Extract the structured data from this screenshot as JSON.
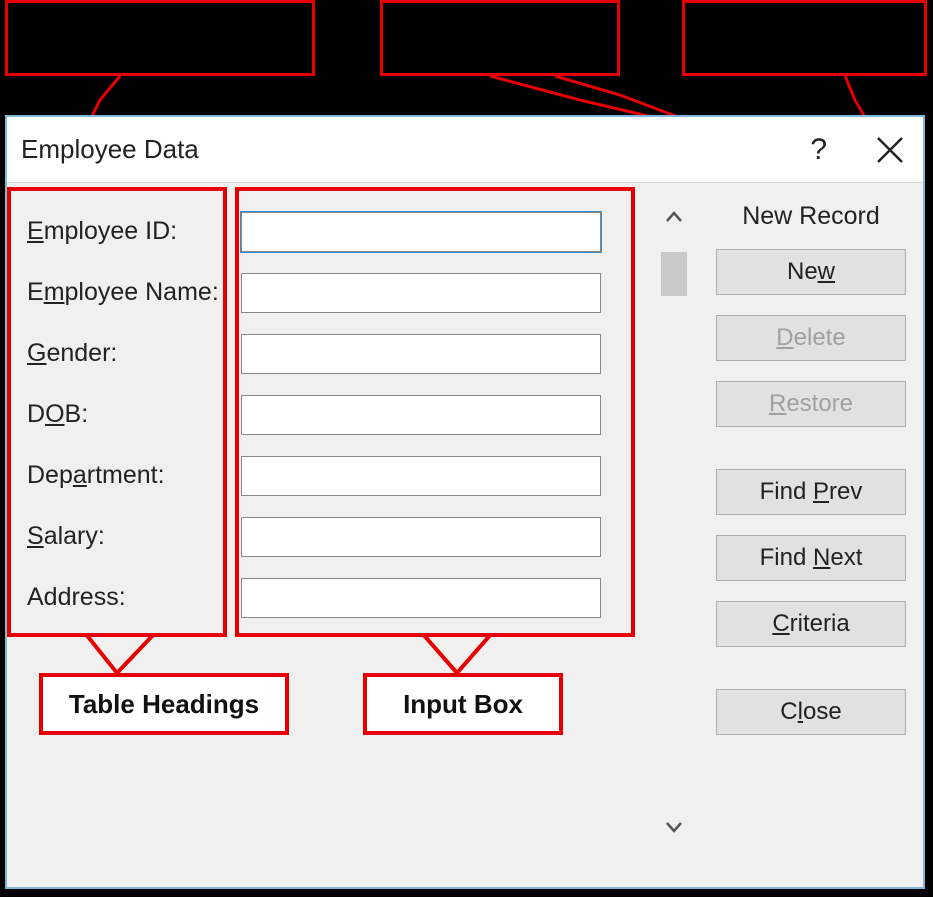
{
  "dialog": {
    "title": "Employee Data",
    "status": "New Record"
  },
  "fields": [
    {
      "label_pre": "",
      "label_u": "E",
      "label_post": "mployee ID:",
      "value": ""
    },
    {
      "label_pre": "E",
      "label_u": "m",
      "label_post": "ployee Name:",
      "value": ""
    },
    {
      "label_pre": "",
      "label_u": "G",
      "label_post": "ender:",
      "value": ""
    },
    {
      "label_pre": "D",
      "label_u": "O",
      "label_post": "B:",
      "value": ""
    },
    {
      "label_pre": "Dep",
      "label_u": "a",
      "label_post": "rtment:",
      "value": ""
    },
    {
      "label_pre": "",
      "label_u": "S",
      "label_post": "alary:",
      "value": ""
    },
    {
      "label_pre": "Address:",
      "label_u": "",
      "label_post": "",
      "value": ""
    }
  ],
  "buttons": {
    "new_pre": "Ne",
    "new_u": "w",
    "new_post": "",
    "delete_pre": "",
    "delete_u": "D",
    "delete_post": "elete",
    "restore_pre": "",
    "restore_u": "R",
    "restore_post": "estore",
    "findprev_pre": "Find ",
    "findprev_u": "P",
    "findprev_post": "rev",
    "findnext_pre": "Find ",
    "findnext_u": "N",
    "findnext_post": "ext",
    "criteria_pre": "",
    "criteria_u": "C",
    "criteria_post": "riteria",
    "close_pre": "C",
    "close_u": "l",
    "close_post": "ose"
  },
  "annotations": {
    "table_headings": "Table Headings",
    "input_box": "Input Box"
  }
}
